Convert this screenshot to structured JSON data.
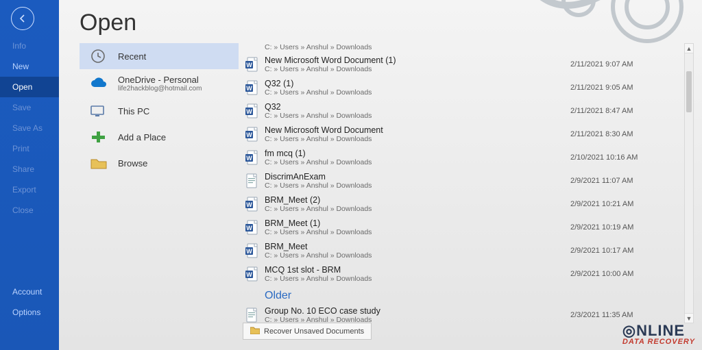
{
  "rail": {
    "items": [
      {
        "label": "Info",
        "dim": true
      },
      {
        "label": "New",
        "dim": false
      },
      {
        "label": "Open",
        "dim": false,
        "active": true
      },
      {
        "label": "Save",
        "dim": true
      },
      {
        "label": "Save As",
        "dim": true
      },
      {
        "label": "Print",
        "dim": true
      },
      {
        "label": "Share",
        "dim": true
      },
      {
        "label": "Export",
        "dim": true
      },
      {
        "label": "Close",
        "dim": true
      }
    ],
    "footer": [
      {
        "label": "Account"
      },
      {
        "label": "Options"
      }
    ]
  },
  "page": {
    "title": "Open"
  },
  "places": [
    {
      "icon": "clock",
      "label": "Recent",
      "selected": true
    },
    {
      "icon": "cloud",
      "label": "OneDrive - Personal",
      "sub": "life2hackblog@hotmail.com"
    },
    {
      "icon": "pc",
      "label": "This PC"
    },
    {
      "icon": "plus",
      "label": "Add a Place"
    },
    {
      "icon": "folder",
      "label": "Browse"
    }
  ],
  "truncated_top_path": "C: » Users » Anshul » Downloads",
  "files": [
    {
      "icon": "word",
      "name": "New Microsoft Word Document (1)",
      "path": "C: » Users » Anshul » Downloads",
      "date": "2/11/2021 9:07 AM"
    },
    {
      "icon": "word",
      "name": "Q32 (1)",
      "path": "C: » Users » Anshul » Downloads",
      "date": "2/11/2021 9:05 AM"
    },
    {
      "icon": "word",
      "name": "Q32",
      "path": "C: » Users » Anshul » Downloads",
      "date": "2/11/2021 8:47 AM"
    },
    {
      "icon": "word",
      "name": "New Microsoft Word Document",
      "path": "C: » Users » Anshul » Downloads",
      "date": "2/11/2021 8:30 AM"
    },
    {
      "icon": "word",
      "name": "fm mcq (1)",
      "path": "C: » Users » Anshul » Downloads",
      "date": "2/10/2021 10:16 AM"
    },
    {
      "icon": "doc",
      "name": "DiscrimAnExam",
      "path": "C: » Users » Anshul » Downloads",
      "date": "2/9/2021 11:07 AM"
    },
    {
      "icon": "word",
      "name": "BRM_Meet (2)",
      "path": "C: » Users » Anshul » Downloads",
      "date": "2/9/2021 10:21 AM"
    },
    {
      "icon": "word",
      "name": "BRM_Meet (1)",
      "path": "C: » Users » Anshul » Downloads",
      "date": "2/9/2021 10:19 AM"
    },
    {
      "icon": "word",
      "name": "BRM_Meet",
      "path": "C: » Users » Anshul » Downloads",
      "date": "2/9/2021 10:17 AM"
    },
    {
      "icon": "word",
      "name": "MCQ 1st slot - BRM",
      "path": "C: » Users » Anshul » Downloads",
      "date": "2/9/2021 10:00 AM"
    }
  ],
  "older_heading": "Older",
  "older": [
    {
      "icon": "doc",
      "name": "Group No. 10 ECO case study",
      "path": "C: » Users » Anshul » Downloads",
      "date": "2/3/2021 11:35 AM"
    }
  ],
  "recover_label": "Recover Unsaved Documents",
  "watermark": {
    "line1": "NLINE",
    "line2": "DATA RECOVERY"
  }
}
